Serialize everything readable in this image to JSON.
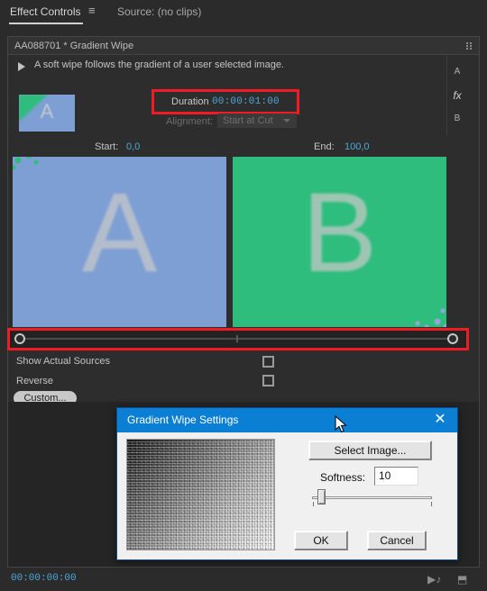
{
  "panel": {
    "tab_label": "Effect Controls",
    "menu_icon": "≡",
    "source_label": "Source: (no clips)"
  },
  "effect": {
    "header_name": "AA088701 * Gradient Wipe",
    "description": "A soft wipe follows the gradient of a user selected image.",
    "disclosure_icon": "▶",
    "track_labels": {
      "a": "A",
      "fx": "fx",
      "b": "B"
    },
    "thumbnail_letter": "A",
    "duration_label": "Duration",
    "duration_value": "00:00:01:00",
    "alignment_label": "Alignment:",
    "alignment_value": "Start at Cut",
    "start_label": "Start:",
    "start_value": "0,0",
    "end_label": "End:",
    "end_value": "100,0",
    "preview_a_letter": "A",
    "preview_b_letter": "B",
    "checkboxes": [
      {
        "label": "Show Actual Sources",
        "checked": false
      },
      {
        "label": "Reverse",
        "checked": false
      }
    ],
    "custom_button": "Custom..."
  },
  "statusbar": {
    "timecode": "00:00:00:00",
    "play_audio_icon": "▶♪",
    "export_frame_icon": "⬒"
  },
  "dialog": {
    "title": "Gradient Wipe Settings",
    "close_icon": "✕",
    "select_image_button": "Select Image...",
    "softness_label": "Softness:",
    "softness_value": "10",
    "ok_button": "OK",
    "cancel_button": "Cancel"
  },
  "colors": {
    "app_background": "#2b2b2b",
    "panel_background": "#2d2d2d",
    "accent_blue": "#4fa8d8",
    "highlight_red": "#ee1c25",
    "dialog_title_blue": "#0b7fd4",
    "preview_a": "#7e9fd4",
    "preview_b": "#2fbd7e"
  }
}
